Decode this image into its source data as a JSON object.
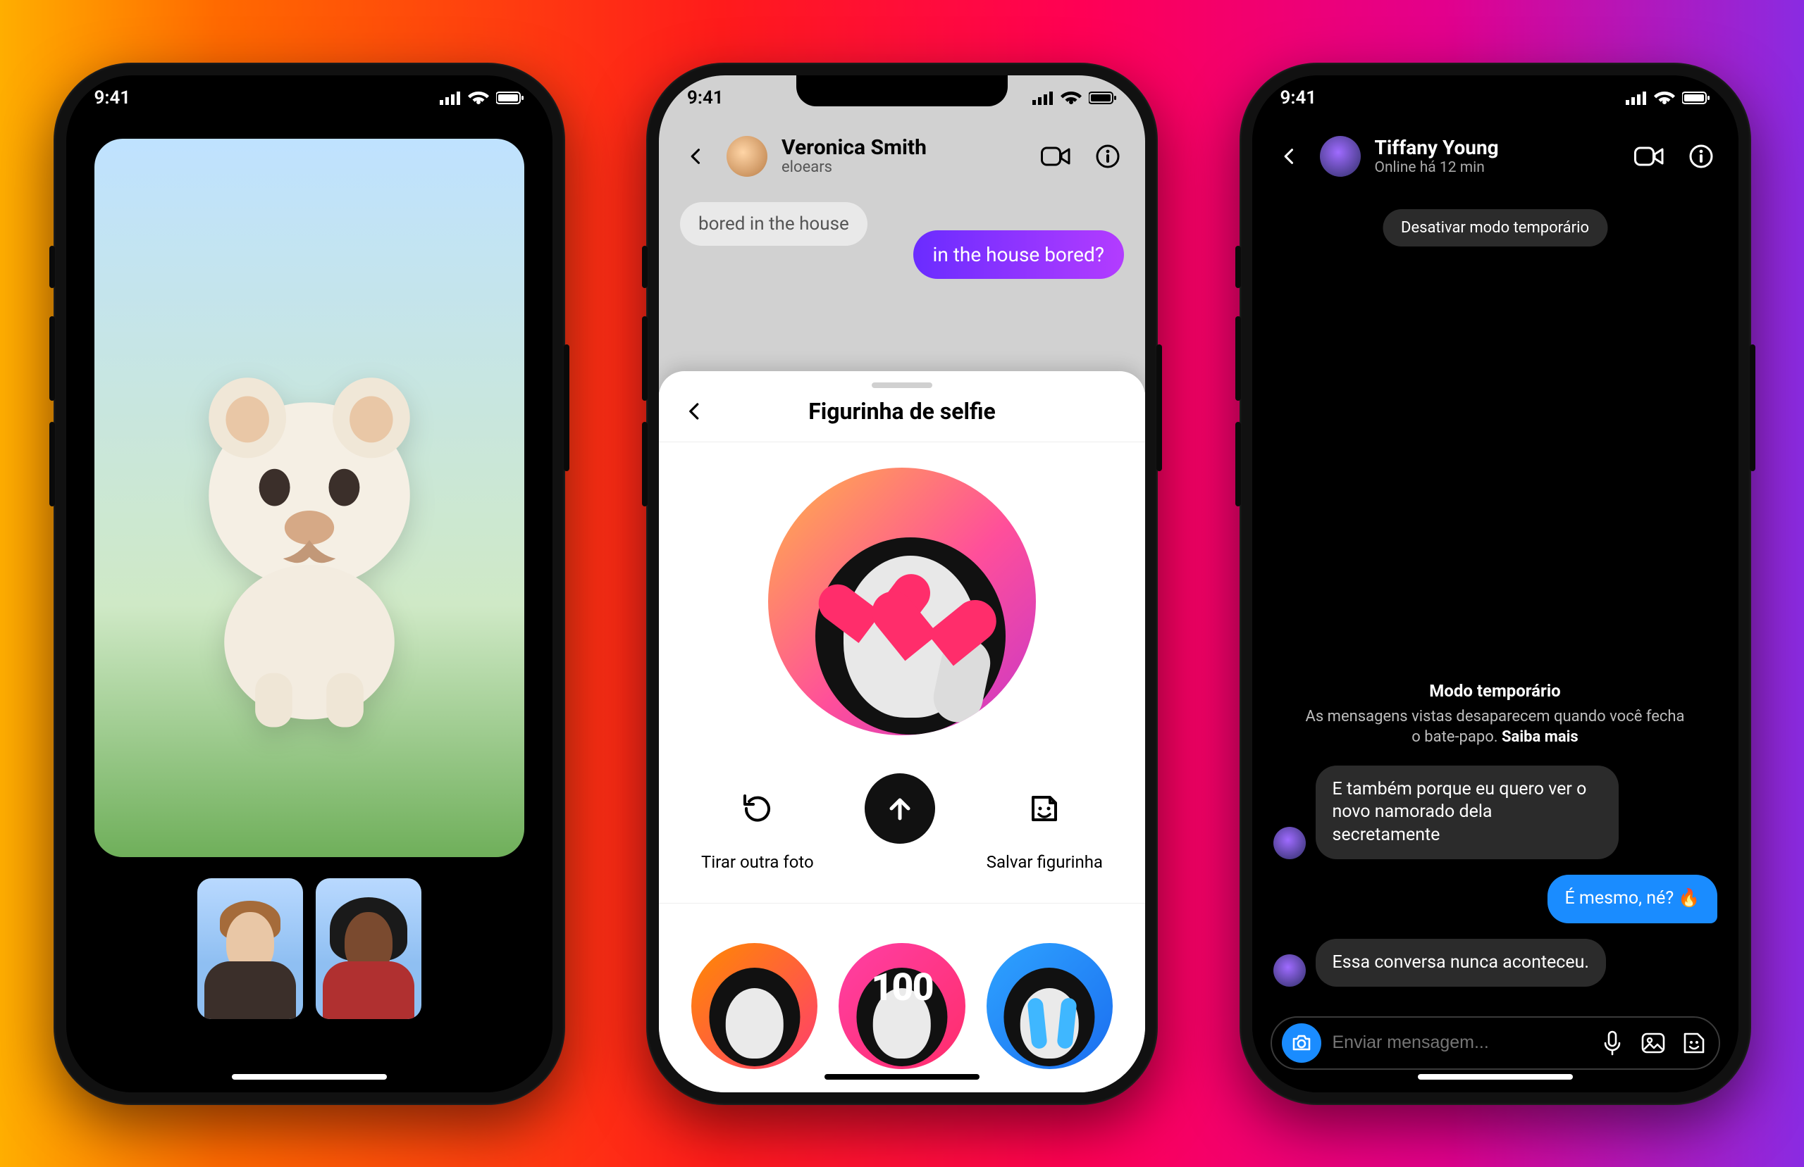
{
  "status": {
    "time": "9:41"
  },
  "phone2": {
    "header": {
      "name": "Veronica Smith",
      "username": "eloears"
    },
    "messages": {
      "incoming_partial": "bored in the house",
      "outgoing": "in the house bored?"
    },
    "sheet": {
      "title": "Figurinha de selfie",
      "retake": "Tirar outra foto",
      "save": "Salvar figurinha",
      "sticker_100": "100"
    }
  },
  "phone3": {
    "header": {
      "name": "Tiffany Young",
      "status": "Online há 12 min"
    },
    "pill": "Desativar modo temporário",
    "vanish": {
      "title": "Modo temporário",
      "desc_prefix": "As mensagens vistas desaparecem quando você fecha o bate-papo. ",
      "learn_more": "Saiba mais"
    },
    "messages": {
      "m1": "E também porque eu quero ver o novo namorado dela secretamente",
      "m2": "É mesmo, né? 🔥",
      "m3": "Essa conversa nunca aconteceu."
    },
    "composer": {
      "placeholder": "Enviar mensagem..."
    }
  }
}
